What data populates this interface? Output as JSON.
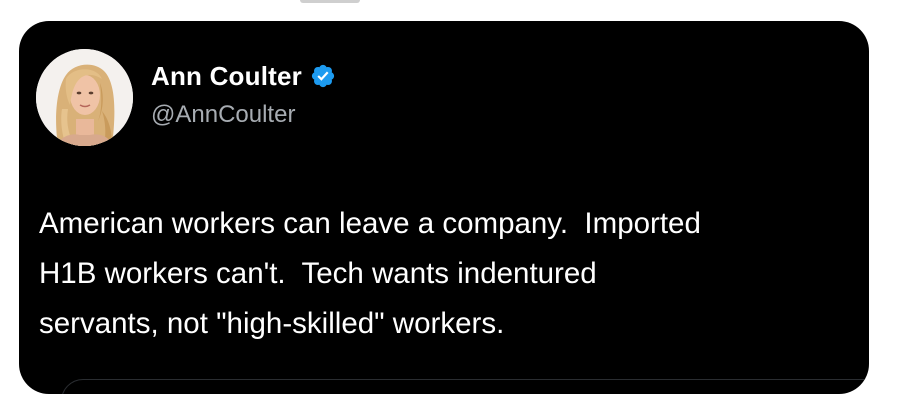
{
  "tweet": {
    "display_name": "Ann Coulter",
    "handle": "@AnnCoulter",
    "verified": true,
    "text_lines": [
      "American workers can leave a company.  Imported",
      "H1B workers can't.  Tech wants indentured",
      "servants, not \"high-skilled\" workers."
    ],
    "avatar_icon": "profile-photo",
    "verified_icon": "verified-badge-icon"
  },
  "colors": {
    "card_background": "#000000",
    "name_text": "#ffffff",
    "handle_text": "#a7acb2",
    "verified_badge": "#1d9bf0"
  }
}
